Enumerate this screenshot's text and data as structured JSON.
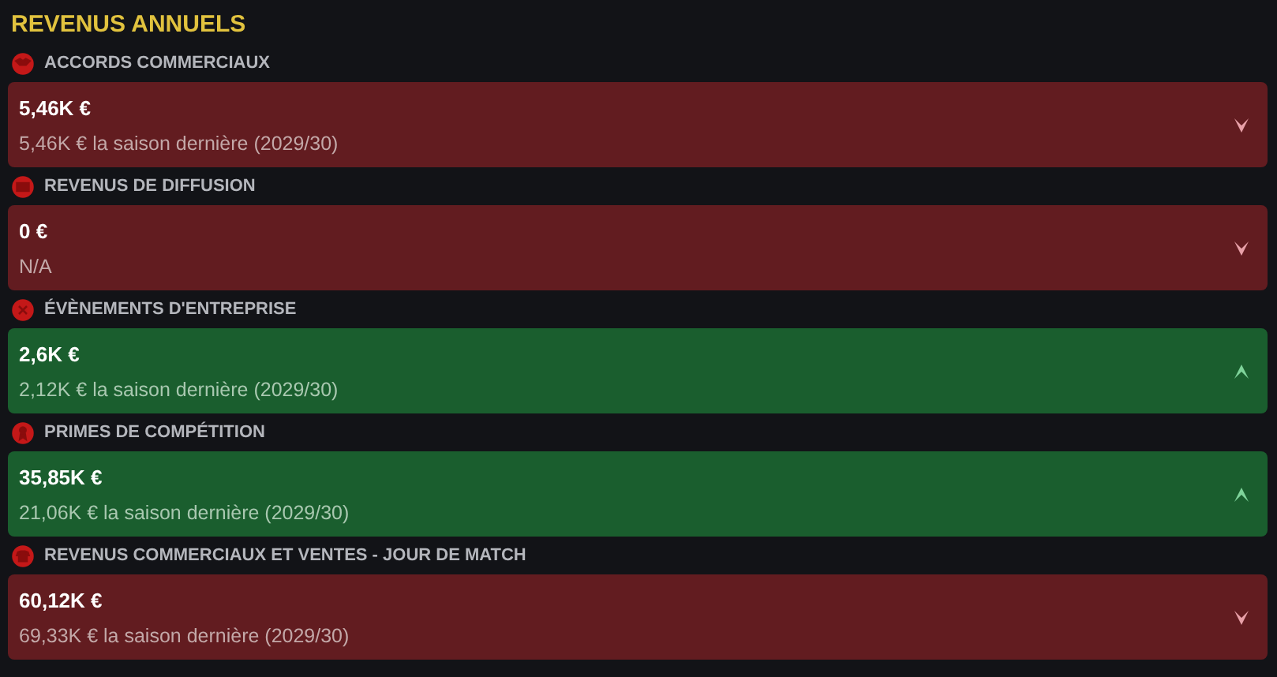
{
  "title": "REVENUS ANNUELS",
  "items": [
    {
      "label": "ACCORDS COMMERCIAUX",
      "value": "5,46K €",
      "previous": "5,46K € la saison dernière (2029/30)",
      "kind": "decrease"
    },
    {
      "label": "REVENUS DE DIFFUSION",
      "value": "0 €",
      "previous": "N/A",
      "kind": "decrease"
    },
    {
      "label": "ÉVÈNEMENTS D'ENTREPRISE",
      "value": "2,6K €",
      "previous": "2,12K € la saison dernière (2029/30)",
      "kind": "increase"
    },
    {
      "label": "PRIMES DE COMPÉTITION",
      "value": "35,85K €",
      "previous": "21,06K € la saison dernière (2029/30)",
      "kind": "increase"
    },
    {
      "label": "REVENUS COMMERCIAUX ET VENTES - JOUR DE MATCH",
      "value": "60,12K €",
      "previous": "69,33K € la saison dernière (2029/30)",
      "kind": "decrease"
    }
  ]
}
